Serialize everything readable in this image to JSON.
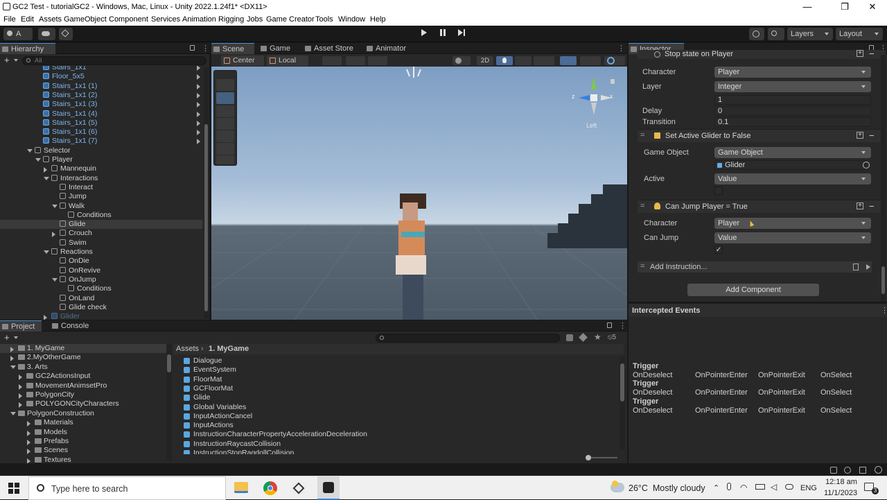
{
  "window": {
    "title": "GC2 Test - tutorialGC2 - Windows, Mac, Linux - Unity 2022.1.24f1* <DX11>",
    "minimize": "—",
    "maximize": "❐",
    "close": "✕"
  },
  "menu": [
    "File",
    "Edit",
    "Assets",
    "GameObject",
    "Component",
    "Services",
    "Animation Rigging",
    "Jobs",
    "Game Creator",
    "Tools",
    "Window",
    "Help"
  ],
  "toolbar": {
    "account": "A",
    "layers": "Layers",
    "layout": "Layout"
  },
  "hierarchy": {
    "tab": "Hierarchy",
    "add": "+",
    "search_placeholder": "All",
    "rows": [
      {
        "label": "Stairs_1x1",
        "indent": 62,
        "blue": true
      },
      {
        "label": "Floor_5x5",
        "indent": 62,
        "blue": true
      },
      {
        "label": "Stairs_1x1 (1)",
        "indent": 62,
        "blue": true
      },
      {
        "label": "Stairs_1x1 (2)",
        "indent": 62,
        "blue": true
      },
      {
        "label": "Stairs_1x1 (3)",
        "indent": 62,
        "blue": true
      },
      {
        "label": "Stairs_1x1 (4)",
        "indent": 62,
        "blue": true
      },
      {
        "label": "Stairs_1x1 (5)",
        "indent": 62,
        "blue": true
      },
      {
        "label": "Stairs_1x1 (6)",
        "indent": 62,
        "blue": true
      },
      {
        "label": "Stairs_1x1 (7)",
        "indent": 62,
        "blue": true
      },
      {
        "label": "Selector",
        "indent": 50,
        "open": true
      },
      {
        "label": "Player",
        "indent": 62,
        "open": true
      },
      {
        "label": "Mannequin",
        "indent": 74,
        "closed": true
      },
      {
        "label": "Interactions",
        "indent": 74,
        "open": true
      },
      {
        "label": "Interact",
        "indent": 86
      },
      {
        "label": "Jump",
        "indent": 86
      },
      {
        "label": "Walk",
        "indent": 86,
        "open": true
      },
      {
        "label": "Conditions",
        "indent": 98
      },
      {
        "label": "Glide",
        "indent": 86,
        "selected": true
      },
      {
        "label": "Crouch",
        "indent": 86,
        "closed": true
      },
      {
        "label": "Swim",
        "indent": 86
      },
      {
        "label": "Reactions",
        "indent": 74,
        "open": true
      },
      {
        "label": "OnDie",
        "indent": 86
      },
      {
        "label": "OnRevive",
        "indent": 86
      },
      {
        "label": "OnJump",
        "indent": 86,
        "open": true
      },
      {
        "label": "Conditions",
        "indent": 98
      },
      {
        "label": "OnLand",
        "indent": 86
      },
      {
        "label": "Glide check",
        "indent": 86
      },
      {
        "label": "Glider",
        "indent": 74,
        "closed": true,
        "blue": true,
        "faded": true
      }
    ]
  },
  "scene": {
    "tabs": [
      "Scene",
      "Game",
      "Asset Store",
      "Animator"
    ],
    "pivot": "Center",
    "space": "Local",
    "mode_2d": "2D",
    "gizmo_x": "x",
    "gizmo_z": "z",
    "view_label": "Left"
  },
  "inspector": {
    "tab": "Inspector",
    "stop_header": "Stop state on Player",
    "fields1": [
      {
        "label": "Character",
        "value": "Player",
        "type": "select"
      },
      {
        "label": "Layer",
        "value": "Integer",
        "type": "select"
      },
      {
        "label": "",
        "value": "1",
        "type": "field"
      },
      {
        "label": "Delay",
        "value": "0",
        "type": "field"
      },
      {
        "label": "Transition",
        "value": "0.1",
        "type": "field"
      }
    ],
    "glider_header": "Set Active Glider to False",
    "game_object_label": "Game Object",
    "game_object_value": "Game Object",
    "glider_ref": "Glider",
    "active_label": "Active",
    "active_value": "Value",
    "jump_header": "Can Jump Player = True",
    "jump_char_label": "Character",
    "jump_char_value": "Player",
    "can_jump_label": "Can Jump",
    "can_jump_value": "Value",
    "check": "✓",
    "add_instruction": "Add Instruction...",
    "add_component": "Add Component",
    "plus": "+",
    "minus": "−",
    "grip": "="
  },
  "events": {
    "title": "Intercepted Events",
    "groups": [
      {
        "trigger": "Trigger",
        "items": [
          "OnDeselect",
          "OnPointerEnter",
          "OnPointerExit",
          "OnSelect"
        ]
      },
      {
        "trigger": "Trigger",
        "items": [
          "OnDeselect",
          "OnPointerEnter",
          "OnPointerExit",
          "OnSelect"
        ]
      },
      {
        "trigger": "Trigger",
        "items": [
          "OnDeselect",
          "OnPointerEnter",
          "OnPointerExit",
          "OnSelect"
        ]
      }
    ]
  },
  "project": {
    "tabs": [
      "Project",
      "Console"
    ],
    "add": "+",
    "hidden_count": "5",
    "folders": [
      {
        "label": "1. MyGame",
        "indent": 26,
        "selected": true
      },
      {
        "label": "2.MyOtherGame",
        "indent": 26
      },
      {
        "label": "3. Arts",
        "indent": 26,
        "open": true
      },
      {
        "label": "GC2ActionsInput",
        "indent": 38
      },
      {
        "label": "MovementAnimsetPro",
        "indent": 38
      },
      {
        "label": "PolygonCity",
        "indent": 38
      },
      {
        "label": "POLYGONCityCharacters",
        "indent": 38
      },
      {
        "label": "PolygonConstruction",
        "indent": 26,
        "open": true
      },
      {
        "label": "Materials",
        "indent": 50
      },
      {
        "label": "Models",
        "indent": 50
      },
      {
        "label": "Prefabs",
        "indent": 50
      },
      {
        "label": "Scenes",
        "indent": 50
      },
      {
        "label": "Textures",
        "indent": 50
      }
    ],
    "breadcrumb_root": "Assets",
    "breadcrumb_sep": "›",
    "breadcrumb_current": "1. MyGame",
    "assets": [
      "Dialogue",
      "EventSystem",
      "FloorMat",
      "GCFloorMat",
      "Glide",
      "Global Variables",
      "InputActionCancel",
      "InputActions",
      "InstructionCharacterPropertyAccelerationDeceleration",
      "InstructionRaycastCollision",
      "InstructionStopRagdollCollision"
    ]
  },
  "taskbar": {
    "search_placeholder": "Type here to search",
    "weather": "26°C  Mostly cloudy",
    "lang": "ENG",
    "time": "12:18 am",
    "date": "11/1/2023",
    "notifications": "3"
  },
  "colors": {
    "accent": "#4a8ed8",
    "selected_row": "#3a3a3a",
    "prefab_blue": "#7fb4ec"
  }
}
